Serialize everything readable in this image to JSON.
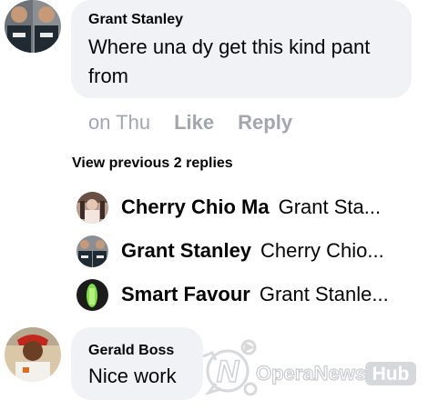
{
  "comments": [
    {
      "author": "Grant Stanley",
      "text_line1": "Where una dy get this kind pant",
      "text_line2": "from"
    },
    {
      "author": "Gerald Boss",
      "text": "Nice work"
    }
  ],
  "meta": {
    "time": "on Thu",
    "like_label": "Like",
    "reply_label": "Reply"
  },
  "view_previous_label": "View previous 2 replies",
  "replies": [
    {
      "author": "Cherry Chio Ma",
      "snippet": "Grant Sta..."
    },
    {
      "author": "Grant Stanley",
      "snippet": "Cherry Chio..."
    },
    {
      "author": "Smart Favour",
      "snippet": "Grant Stanle..."
    }
  ],
  "watermark": {
    "part1": "OperaNews",
    "part2": "Hub"
  },
  "colors": {
    "bubble": "#f0f2f5",
    "meta_text": "#a3a7ad",
    "text": "#050505"
  },
  "icons": {
    "avatars": "profile-photo",
    "watermark": "operanews-logo"
  }
}
